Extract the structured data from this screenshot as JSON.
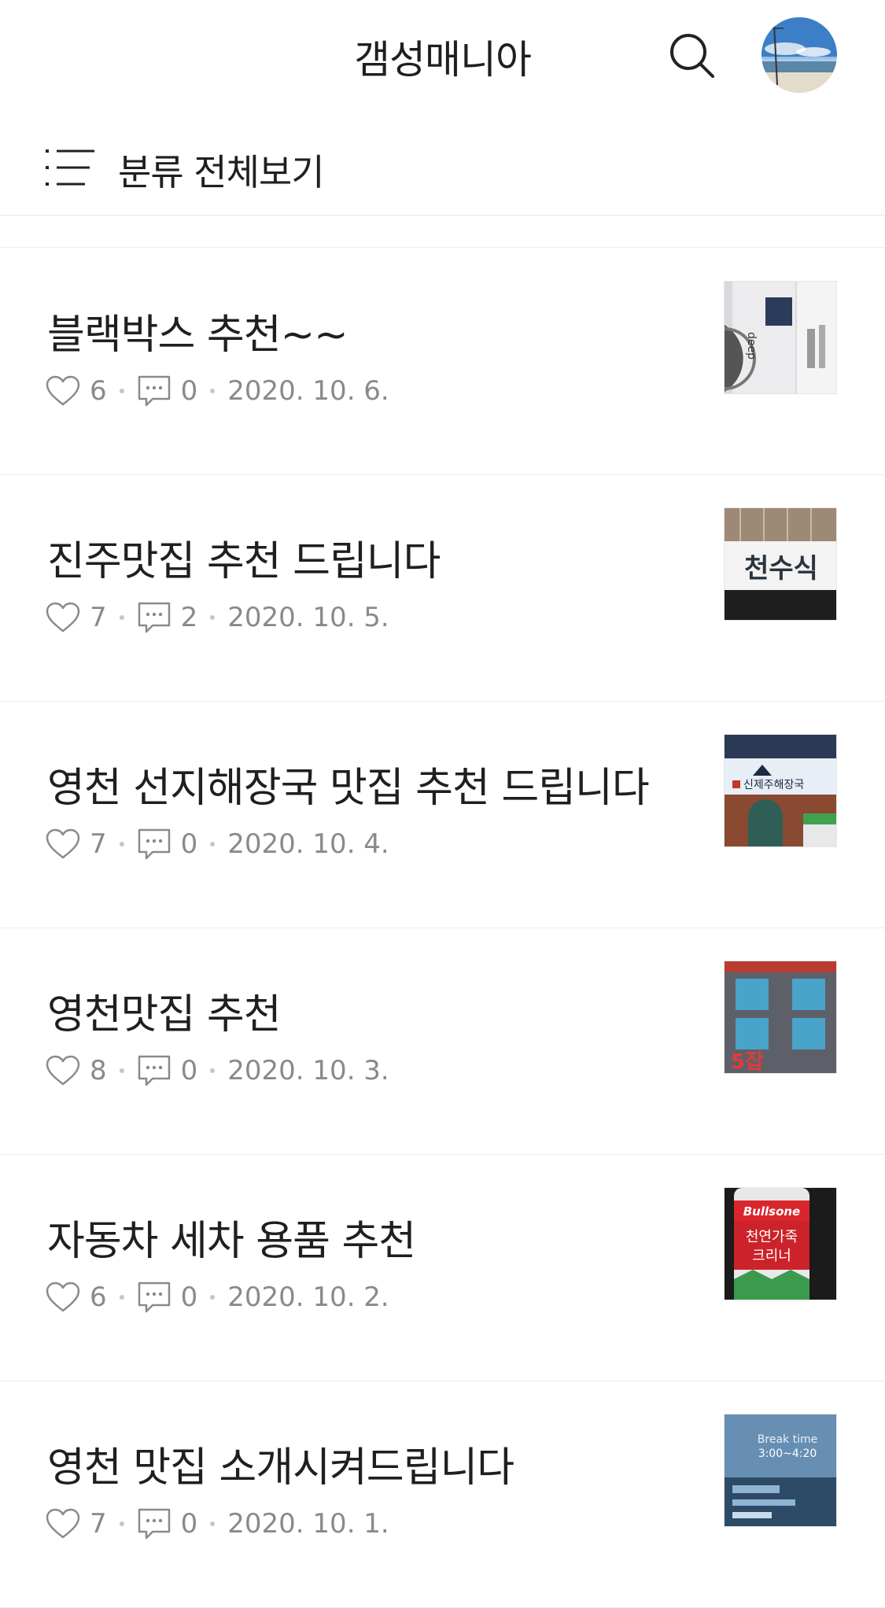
{
  "header": {
    "blog_title": "갬성매니아",
    "search_icon": "search-icon",
    "avatar_icon": "profile-avatar"
  },
  "category": {
    "label": "분류 전체보기",
    "icon": "list-menu-icon"
  },
  "posts": [
    {
      "title": "블랙박스 추천~~",
      "likes": "6",
      "comments": "0",
      "date": "2020. 10. 6."
    },
    {
      "title": "진주맛집 추천 드립니다",
      "likes": "7",
      "comments": "2",
      "date": "2020. 10. 5."
    },
    {
      "title": "영천 선지해장국 맛집 추천 드립니다",
      "likes": "7",
      "comments": "0",
      "date": "2020. 10. 4."
    },
    {
      "title": "영천맛집 추천",
      "likes": "8",
      "comments": "0",
      "date": "2020. 10. 3."
    },
    {
      "title": "자동차 세차 용품 추천",
      "likes": "6",
      "comments": "0",
      "date": "2020. 10. 2."
    },
    {
      "title": "영천 맛집 소개시켜드립니다",
      "likes": "7",
      "comments": "0",
      "date": "2020. 10. 1."
    }
  ],
  "thumb_text": {
    "t2_sign": "천수식",
    "t3_sign": "신제주해장국",
    "t4_sign": "5잡",
    "t5_brand": "Bullsone",
    "t5_line1": "천연가죽",
    "t5_line2": "크리너",
    "t6_line1": "Break time",
    "t6_line2": "3:00~4:20"
  }
}
